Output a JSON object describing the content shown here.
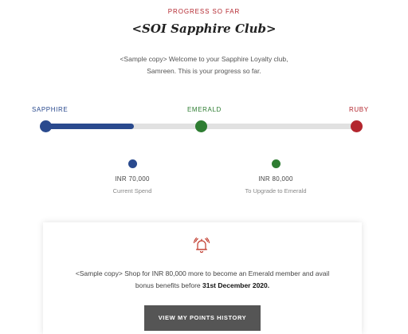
{
  "header": {
    "eyebrow": "PROGRESS SO FAR",
    "title": "<SOI Sapphire Club>",
    "intro": "<Sample copy> Welcome to your Sapphire Loyalty club, Samreen. This is your progress so far."
  },
  "tiers": [
    {
      "label": "SAPPHIRE",
      "color": "#2a4a8e"
    },
    {
      "label": "EMERALD",
      "color": "#2e7d32"
    },
    {
      "label": "RUBY",
      "color": "#b3262e"
    }
  ],
  "progress": {
    "fraction_to_emerald": 0.55
  },
  "stats": {
    "current": {
      "value": "INR 70,000",
      "caption": "Current Spend"
    },
    "upgrade": {
      "value": "INR 80,000",
      "caption": "To Upgrade to Emerald"
    }
  },
  "card": {
    "icon": "bell-alert-icon",
    "text_before": "<Sample copy> Shop for INR 80,000 more to become an Emerald member and avail bonus benefits before ",
    "text_bold": "31st December 2020.",
    "button_label": "VIEW MY POINTS HISTORY"
  }
}
